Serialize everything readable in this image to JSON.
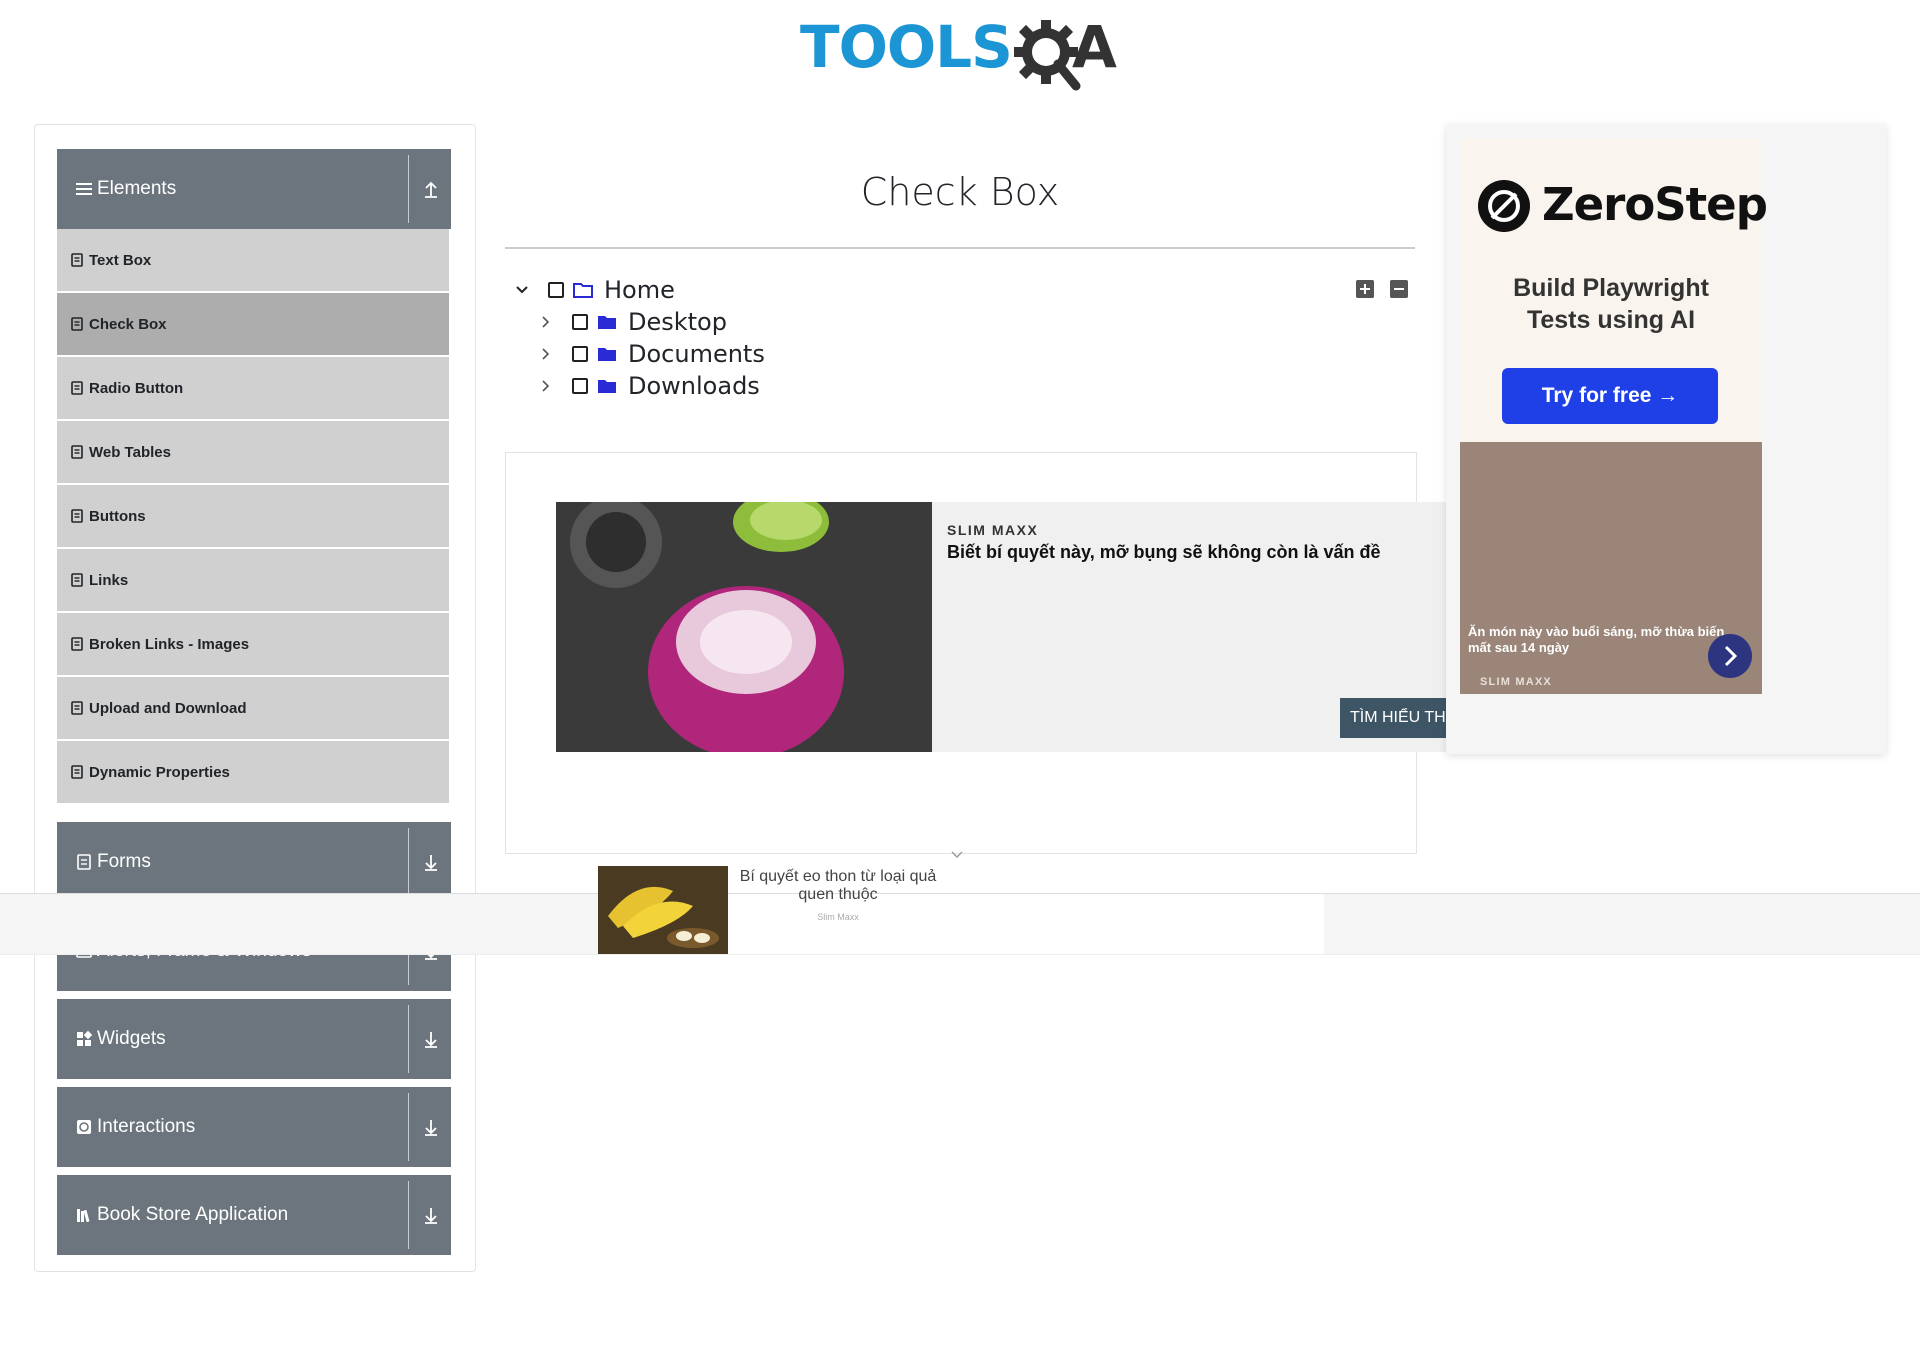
{
  "logo": {
    "text": "TOOLS",
    "suffix": "A",
    "alt": "TOOLSQA"
  },
  "sidebar": {
    "groups": [
      {
        "label": "Elements",
        "icon": "menu-icon",
        "arrow": "arrow-up-icon"
      },
      {
        "label": "Forms",
        "icon": "form-icon",
        "arrow": "arrow-down-icon"
      },
      {
        "label": "Alerts, Frame & Windows",
        "icon": "window-icon",
        "arrow": "arrow-down-icon"
      },
      {
        "label": "Widgets",
        "icon": "widgets-icon",
        "arrow": "arrow-down-icon"
      },
      {
        "label": "Interactions",
        "icon": "interactions-icon",
        "arrow": "arrow-down-icon"
      },
      {
        "label": "Book Store Application",
        "icon": "book-icon",
        "arrow": "arrow-down-icon"
      }
    ],
    "items": [
      {
        "label": "Text Box"
      },
      {
        "label": "Check Box",
        "active": true
      },
      {
        "label": "Radio Button"
      },
      {
        "label": "Web Tables"
      },
      {
        "label": "Buttons"
      },
      {
        "label": "Links"
      },
      {
        "label": "Broken Links - Images"
      },
      {
        "label": "Upload and Download"
      },
      {
        "label": "Dynamic Properties"
      }
    ]
  },
  "main": {
    "title": "Check Box",
    "tree": [
      {
        "label": "Home",
        "expanded": true,
        "checked": false
      },
      {
        "label": "Desktop",
        "expanded": false,
        "checked": false
      },
      {
        "label": "Documents",
        "expanded": false,
        "checked": false
      },
      {
        "label": "Downloads",
        "expanded": false,
        "checked": false
      }
    ]
  },
  "content_ad": {
    "brand": "SLIM MAXX",
    "headline": "Biết bí quyết này, mỡ bụng sẽ không còn là vấn đề",
    "cta": "TÌM HIỂU THÊM"
  },
  "side_ad": {
    "name": "ZeroStep",
    "tagline_line1": "Build Playwright",
    "tagline_line2": "Tests using AI",
    "button": "Try for free →",
    "slim_text": "Ăn món này vào buổi sáng, mỡ thừa biến mất sau 14 ngày",
    "slim_brand": "SLIM MAXX"
  },
  "sticky_ad": {
    "title": "Bí quyết eo thon từ loại quả quen thuộc",
    "brand": "Slim Maxx"
  },
  "colors": {
    "sidebar_header": "#6c757d",
    "menu_item": "#d0d0d0",
    "menu_item_active": "#adadad",
    "folder": "#2b2bd6",
    "logo_blue": "#1B95D3",
    "zerostep_button": "#1e40e6"
  }
}
